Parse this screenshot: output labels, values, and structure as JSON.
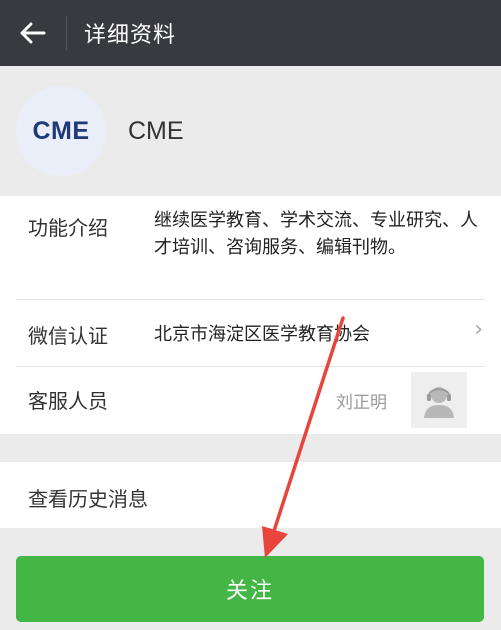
{
  "header": {
    "back_icon": "arrow-left-icon",
    "title": "详细资料"
  },
  "profile": {
    "avatar_text": "CME",
    "name": "CME"
  },
  "info": {
    "function_label": "功能介绍",
    "function_value": "继续医学教育、学术交流、专业研究、人才培训、咨询服务、编辑刊物。",
    "cert_label": "微信认证",
    "cert_value": "北京市海淀区医学教育协会",
    "cert_chevron": "›",
    "service_label": "客服人员",
    "service_name": "刘正明",
    "service_avatar_icon": "person-headset-icon"
  },
  "history": {
    "label": "查看历史消息"
  },
  "follow_button": {
    "label": "关注",
    "color": "#43b645"
  },
  "annotation": {
    "color": "#e8453c"
  },
  "colors": {
    "topbar": "#393a3f",
    "background": "#ebebeb",
    "card": "#ffffff"
  }
}
